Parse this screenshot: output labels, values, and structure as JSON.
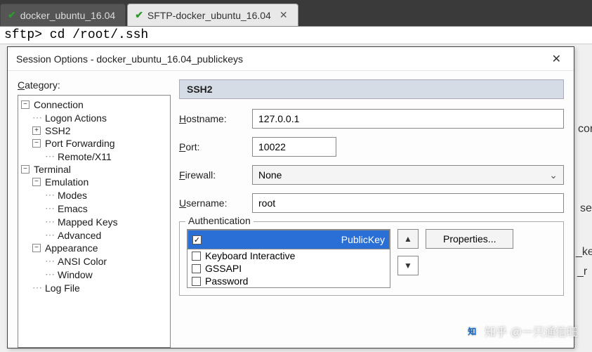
{
  "tabs": [
    {
      "label": "docker_ubuntu_16.04",
      "active": false
    },
    {
      "label": "SFTP-docker_ubuntu_16.04",
      "active": true
    }
  ],
  "terminal_line": "sftp> cd /root/.ssh",
  "bg_fragments": {
    "a": "cor",
    "b": "se",
    "c": "_ke",
    "d": "_r"
  },
  "dialog": {
    "title": "Session Options - docker_ubuntu_16.04_publickeys",
    "close_glyph": "✕",
    "category_label_pre": "C",
    "category_label_post": "ategory:",
    "tree": {
      "connection": "Connection",
      "logon": "Logon Actions",
      "ssh2": "SSH2",
      "port_fwd": "Port Forwarding",
      "remote": "Remote/X11",
      "terminal": "Terminal",
      "emulation": "Emulation",
      "modes": "Modes",
      "emacs": "Emacs",
      "mapped": "Mapped Keys",
      "advanced": "Advanced",
      "appearance": "Appearance",
      "ansi": "ANSI Color",
      "window": "Window",
      "logfile": "Log File"
    },
    "section_header": "SSH2",
    "labels": {
      "hostname_u": "H",
      "hostname_r": "ostname:",
      "port_u": "P",
      "port_r": "ort:",
      "firewall_u": "F",
      "firewall_r": "irewall:",
      "username_u": "U",
      "username_r": "sername:",
      "auth": "Authentication"
    },
    "values": {
      "hostname": "127.0.0.1",
      "port": "10022",
      "firewall": "None",
      "username": "root"
    },
    "auth_options": [
      {
        "label": "PublicKey",
        "checked": true,
        "selected": true
      },
      {
        "label": "Keyboard Interactive",
        "checked": false,
        "selected": false
      },
      {
        "label": "GSSAPI",
        "checked": false,
        "selected": false
      },
      {
        "label": "Password",
        "checked": false,
        "selected": false
      }
    ],
    "properties_btn": "Properties...",
    "arrow_up": "▲",
    "arrow_down": "▼"
  },
  "watermark": "知乎 @一只通信旺"
}
